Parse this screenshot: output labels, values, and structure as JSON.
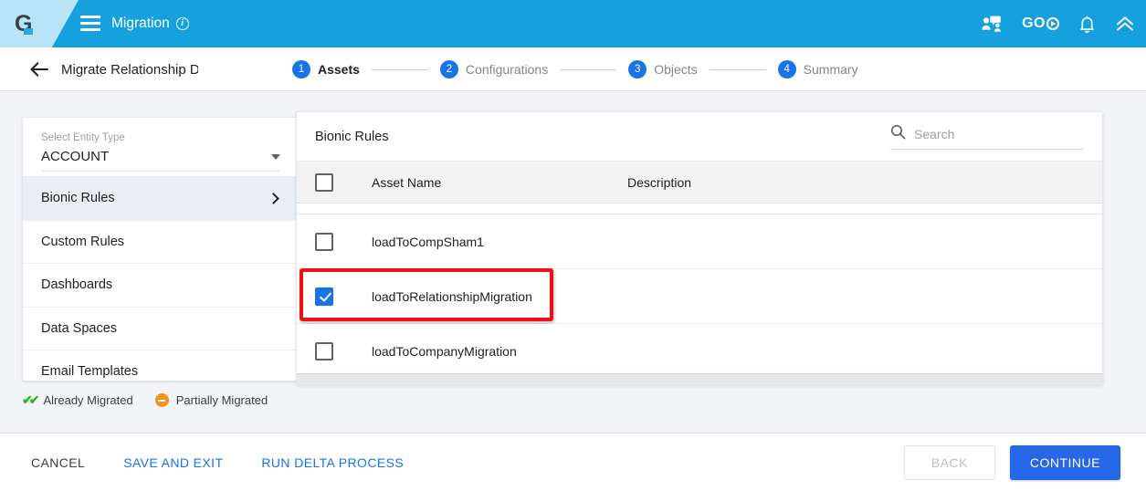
{
  "topbar": {
    "logo_text": "G",
    "menu_icon": "hamburger-icon",
    "app_title": "Migration",
    "info_icon": "i",
    "users_icon": "users-chat-icon",
    "go_label": "GO",
    "bell_icon": "bell-icon",
    "collapse_icon": "double-chevron-up-icon",
    "accent_blue": "#16a0de"
  },
  "subheader": {
    "back_icon": "back-arrow-icon",
    "page_title": "Migrate Relationship Dep",
    "steps": [
      {
        "num": "1",
        "label": "Assets",
        "active": true
      },
      {
        "num": "2",
        "label": "Configurations",
        "active": false
      },
      {
        "num": "3",
        "label": "Objects",
        "active": false
      },
      {
        "num": "4",
        "label": "Summary",
        "active": false
      }
    ]
  },
  "sidebar": {
    "select_label": "Select Entity Type",
    "select_value": "ACCOUNT",
    "items": [
      {
        "label": "Bionic Rules",
        "selected": true
      },
      {
        "label": "Custom Rules",
        "selected": false
      },
      {
        "label": "Dashboards",
        "selected": false
      },
      {
        "label": "Data Spaces",
        "selected": false
      },
      {
        "label": "Email Templates",
        "selected": false
      }
    ]
  },
  "table": {
    "title": "Bionic Rules",
    "search_placeholder": "Search",
    "search_value": "",
    "columns": {
      "asset_name": "Asset Name",
      "description": "Description"
    },
    "rows": [
      {
        "name": "loadToCompSham1",
        "description": "",
        "checked": false,
        "highlighted": false
      },
      {
        "name": "loadToRelationshipMigration",
        "description": "",
        "checked": true,
        "highlighted": true
      },
      {
        "name": "loadToCompanyMigration",
        "description": "",
        "checked": false,
        "highlighted": false
      }
    ]
  },
  "legend": {
    "already_migrated": "Already Migrated",
    "partially_migrated": "Partially Migrated",
    "already_color": "#2eb82e",
    "partial_color": "#f5911e"
  },
  "footer": {
    "cancel": "CANCEL",
    "save_and_exit": "SAVE AND EXIT",
    "run_delta_process": "RUN DELTA PROCESS",
    "back": "BACK",
    "continue": "CONTINUE",
    "primary_color": "#2667e8"
  }
}
